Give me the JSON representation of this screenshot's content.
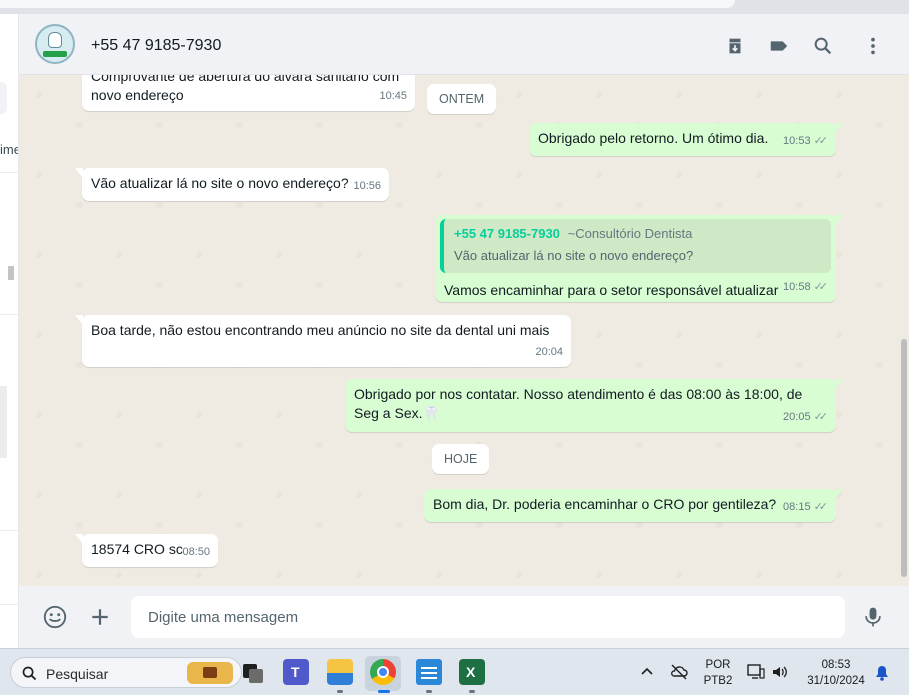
{
  "header": {
    "contact_name": "+55 47 9185-7930",
    "icons": [
      "archive-icon",
      "label-icon",
      "search-icon",
      "menu-dots-icon"
    ]
  },
  "left_panel": {
    "cut_text": "ime"
  },
  "messages": [
    {
      "id": "m1",
      "dir": "in",
      "text": "Comprovante de abertura do alvará sanitário com novo endereço",
      "time": "10:45"
    },
    {
      "id": "day1",
      "type": "day",
      "label": "ONTEM"
    },
    {
      "id": "m2",
      "dir": "out",
      "text": "Obrigado pelo retorno. Um ótimo dia.",
      "time": "10:53"
    },
    {
      "id": "m3",
      "dir": "in",
      "text": "Vão atualizar lá no site o novo endereço?",
      "time": "10:56"
    },
    {
      "id": "m4",
      "dir": "out",
      "quote_name": "+55 47 9185-7930",
      "quote_sub": "~Consultório Dentista",
      "quote_text": "Vão atualizar lá no site o novo endereço?",
      "text": "Vamos encaminhar para o setor responsável atualizar",
      "time": "10:58"
    },
    {
      "id": "m5",
      "dir": "in",
      "text": "Boa tarde, não estou encontrando meu anúncio no site da dental uni mais",
      "time": "20:04"
    },
    {
      "id": "m6",
      "dir": "out",
      "text": "Obrigado por nos contatar. Nosso atendimento é das 08:00 às 18:00, de Seg a Sex.🦷",
      "time": "20:05"
    },
    {
      "id": "day2",
      "type": "day",
      "label": "HOJE"
    },
    {
      "id": "m7",
      "dir": "out",
      "text": "Bom dia, Dr. poderia encaminhar o CRO por gentileza?",
      "time": "08:15"
    },
    {
      "id": "m8",
      "dir": "in",
      "text": "18574 CRO sc",
      "time": "08:50"
    }
  ],
  "composer": {
    "placeholder": "Digite uma mensagem",
    "icons": [
      "emoji-icon",
      "plus-icon",
      "microphone-icon"
    ]
  },
  "taskbar": {
    "search_label": "Pesquisar",
    "apps": [
      "task-view-icon",
      "teams-icon",
      "file-explorer-icon",
      "chrome-icon",
      "notepad-icon",
      "excel-icon"
    ],
    "language_line1": "POR",
    "language_line2": "PTB2",
    "time": "08:53",
    "date": "31/10/2024"
  },
  "colors": {
    "outgoing_bubble": "#d9fdd3",
    "incoming_bubble": "#ffffff",
    "chat_background": "#efeae2",
    "quote_accent": "#06cf9c",
    "tick_gray": "#8696a0"
  }
}
